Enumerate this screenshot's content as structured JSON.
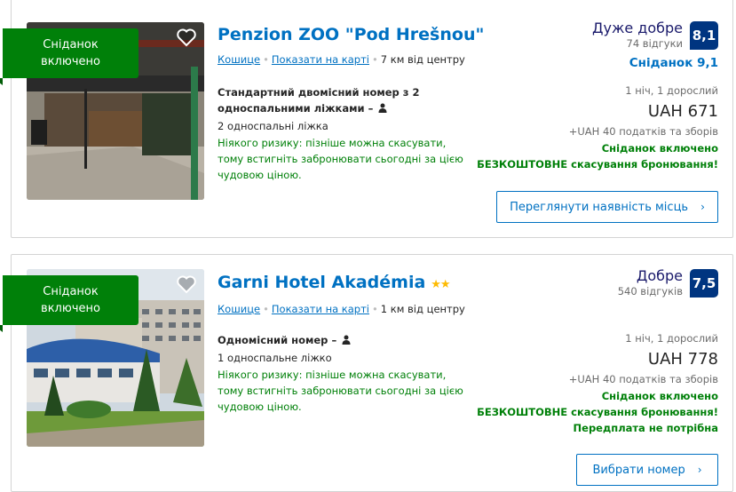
{
  "hotels": [
    {
      "ribbon": "Сніданок включено",
      "name": "Penzion ZOO \"Pod Hrešnou\"",
      "stars": "",
      "location": {
        "city": "Кошице",
        "map_link": "Показати на карті",
        "distance": "7 км від центру"
      },
      "room": {
        "title": "Стандартний двомісний номер з 2 односпальними ліжками",
        "beds": "2 односпальні ліжка",
        "no_risk": "Ніякого ризику: пізніше можна скасувати, тому встигніть забронювати сьогодні за цією чудовою ціною."
      },
      "rating": {
        "word": "Дуже добре",
        "reviews": "74 відгуки",
        "score": "8,1",
        "sub_score": "Сніданок 9,1"
      },
      "price": {
        "nights": "1 ніч, 1 дорослий",
        "amount": "UAH 671",
        "taxes": "+UAH 40 податків та зборів"
      },
      "perks": [
        "Сніданок включено",
        "БЕЗКОШТОВНЕ скасування бронювання!"
      ],
      "button": "Переглянути наявність місць"
    },
    {
      "ribbon": "Сніданок включено",
      "name": "Garni Hotel Akadémia",
      "stars": "★★",
      "location": {
        "city": "Кошице",
        "map_link": "Показати на карті",
        "distance": "1 км від центру"
      },
      "room": {
        "title": "Одномісний номер",
        "beds": "1 односпальне ліжко",
        "no_risk": "Ніякого ризику: пізніше можна скасувати, тому встигніть забронювати сьогодні за цією чудовою ціною."
      },
      "rating": {
        "word": "Добре",
        "reviews": "540 відгуків",
        "score": "7,5"
      },
      "price": {
        "nights": "1 ніч, 1 дорослий",
        "amount": "UAH 778",
        "taxes": "+UAH 40 податків та зборів"
      },
      "perks": [
        "Сніданок включено",
        "БЕЗКОШТОВНЕ скасування бронювання!",
        "Передплата не потрібна"
      ],
      "button": "Вибрати номер"
    }
  ],
  "colors": {
    "accent": "#0071c2",
    "green": "#008009",
    "score_bg": "#003580",
    "star": "#febb02"
  }
}
